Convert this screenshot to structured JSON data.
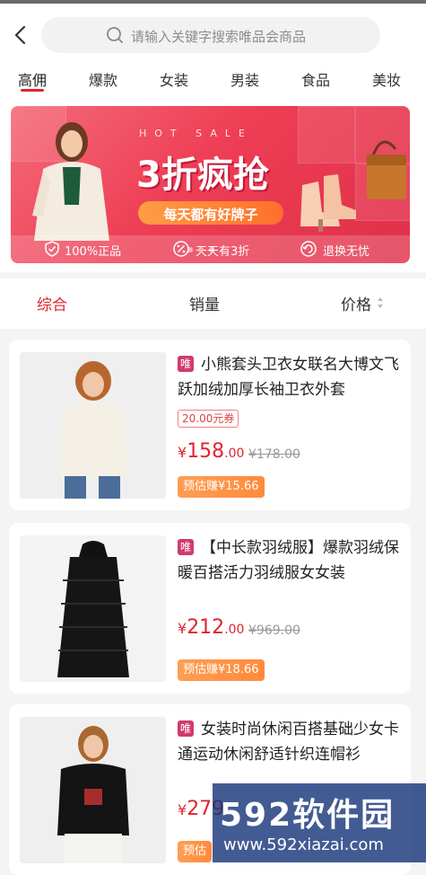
{
  "search": {
    "placeholder": "请输入关键字搜索唯品会商品"
  },
  "tabs": [
    "高佣",
    "爆款",
    "女装",
    "男装",
    "食品",
    "美妆"
  ],
  "banner": {
    "hot_sale": "HOT SALE",
    "headline": "3折疯抢",
    "pill": "每天都有好牌子",
    "features": [
      "100%正品",
      "天天有3折",
      "退换无忧"
    ]
  },
  "sort": {
    "comprehensive": "综合",
    "sales": "销量",
    "price": "价格"
  },
  "products": [
    {
      "tag": "唯",
      "title": "小熊套头卫衣女联名大博文飞跃加绒加厚长袖卫衣外套",
      "coupon": "20.00元券",
      "currency": "¥",
      "price_int": "158",
      "price_dec": ".00",
      "original": "¥178.00",
      "earn": "预估赚¥15.66"
    },
    {
      "tag": "唯",
      "title": "【中长款羽绒服】爆款羽绒保暖百搭活力羽绒服女女装",
      "currency": "¥",
      "price_int": "212",
      "price_dec": ".00",
      "original": "¥969.00",
      "earn": "预估赚¥18.66"
    },
    {
      "tag": "唯",
      "title": "女装时尚休闲百搭基础少女卡通运动休闲舒适针织连帽衫",
      "currency": "¥",
      "price_int": "279",
      "earn": "预估"
    }
  ],
  "watermark": {
    "brand": "592软件园",
    "url": "www.592xiazai.com"
  },
  "colors": {
    "accent": "#e0242f",
    "vip_tag": "#d23a6c",
    "earn": "#ff8a3d"
  }
}
